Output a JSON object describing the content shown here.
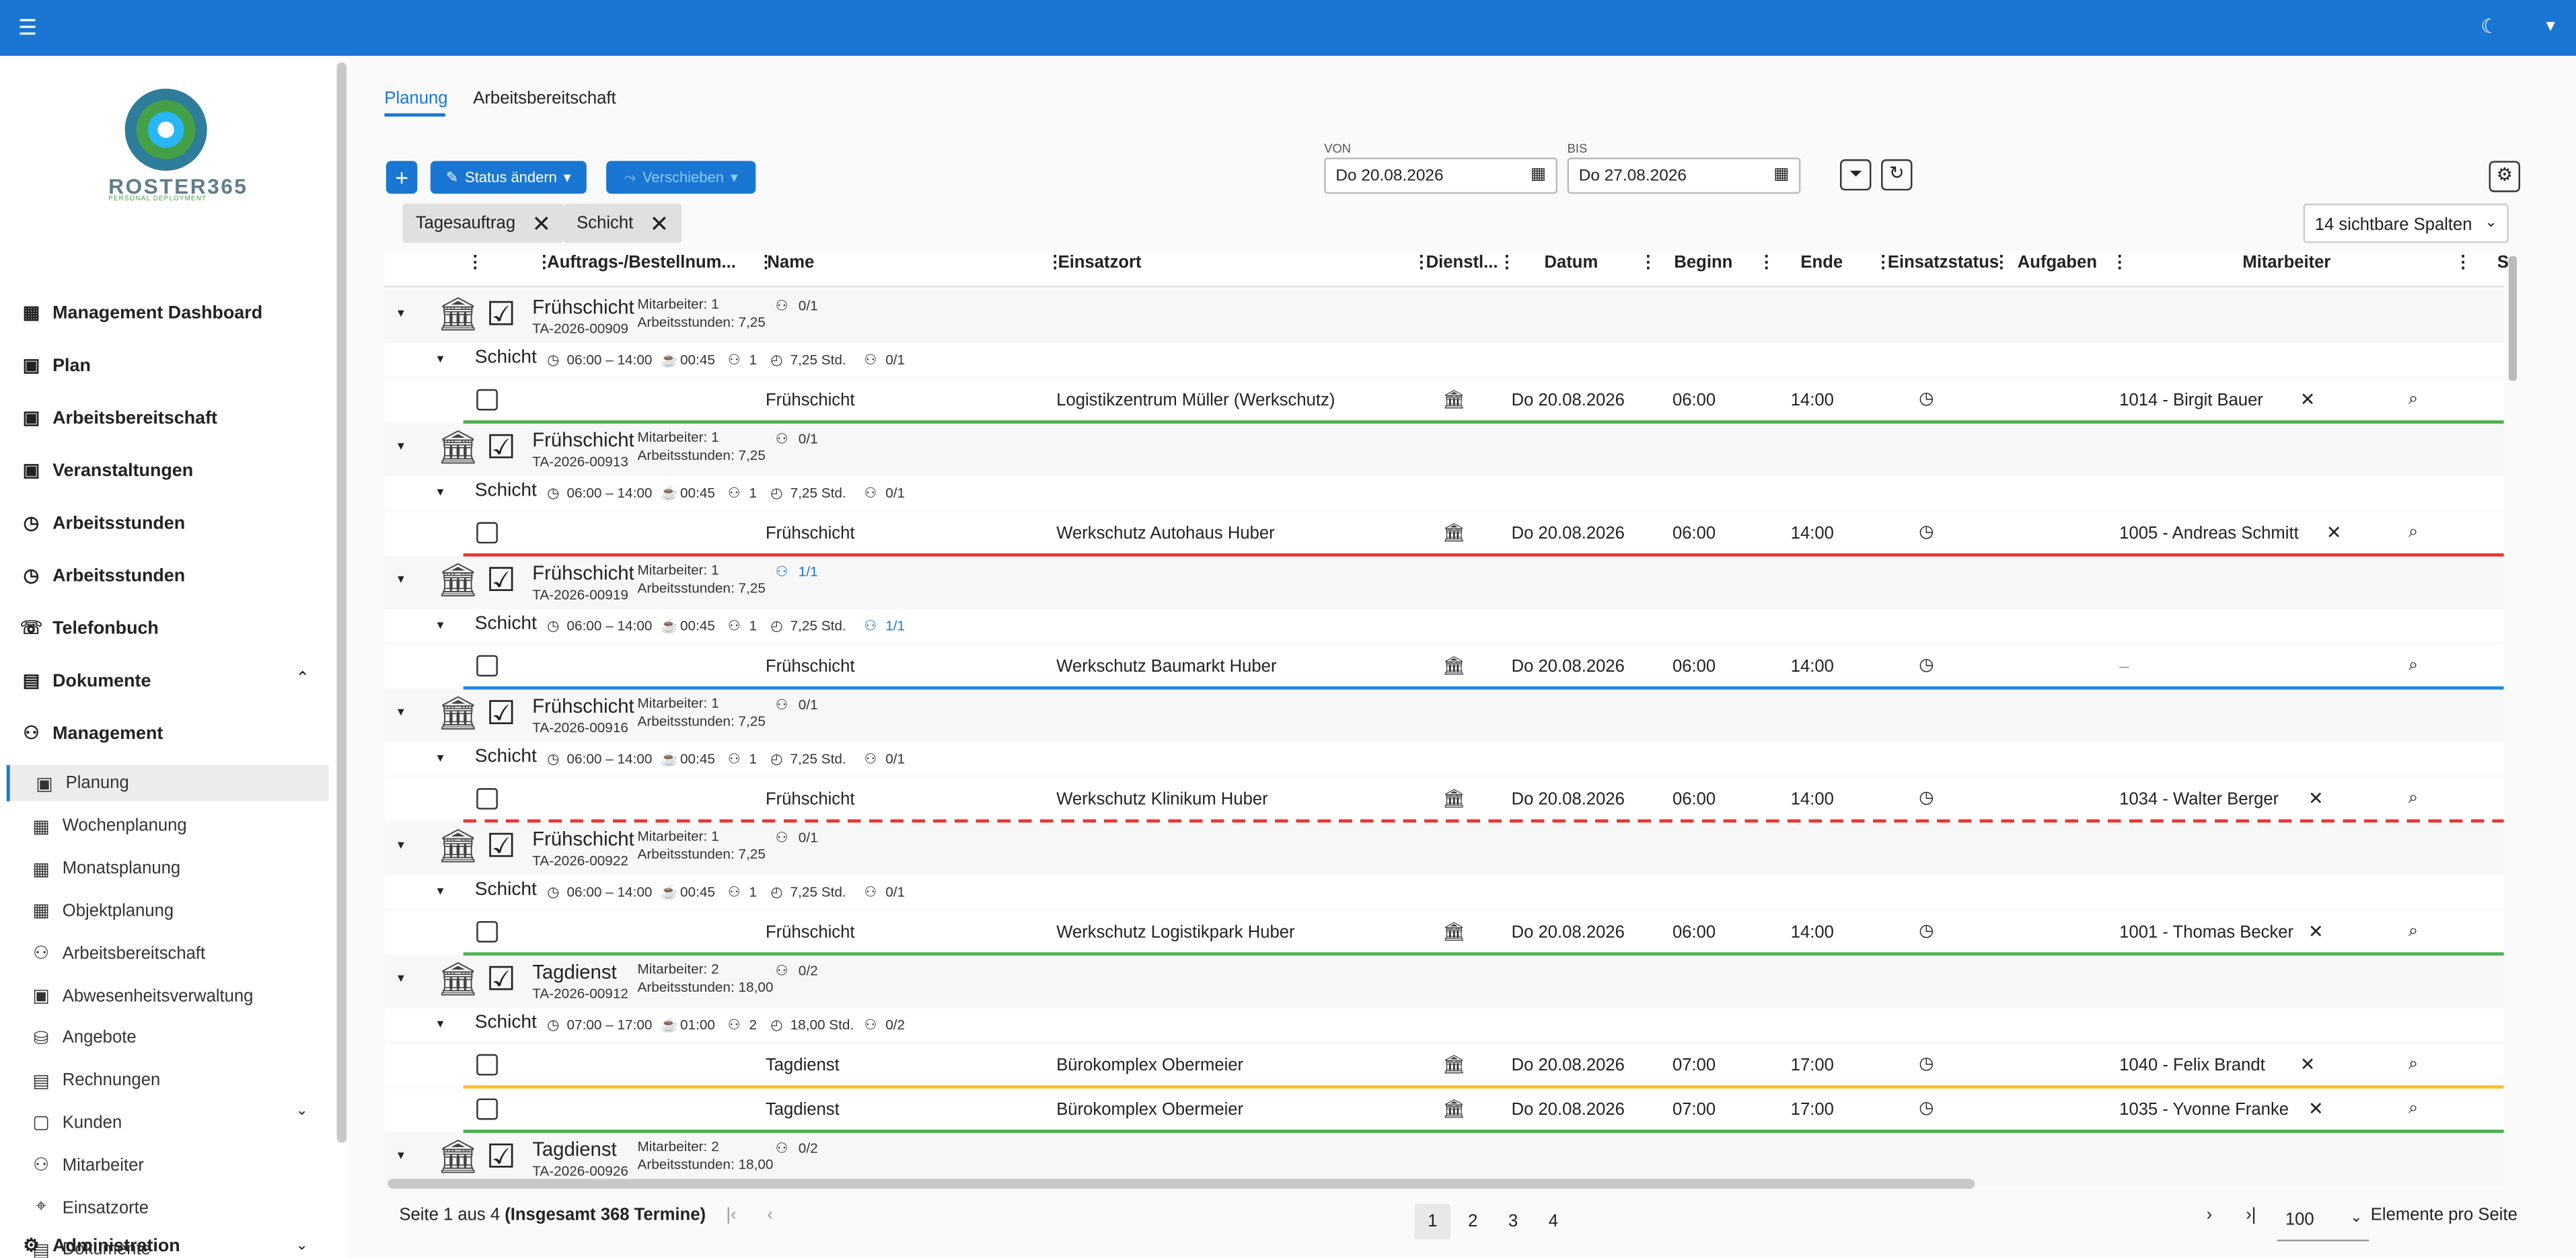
{
  "topbar": {
    "menu_icon": "menu-icon",
    "theme_icon": "moon-icon",
    "user_icon": "user-icon"
  },
  "logo": {
    "text": "ROSTER365",
    "tagline": "PERSONAL DEPLOYMENT"
  },
  "sidebar": {
    "main": [
      {
        "label": "Management Dashboard",
        "icon": "dashboard-icon"
      },
      {
        "label": "Plan",
        "icon": "calendar-icon"
      },
      {
        "label": "Arbeitsbereitschaft",
        "icon": "calendar-user-icon"
      },
      {
        "label": "Veranstaltungen",
        "icon": "calendar-icon"
      },
      {
        "label": "Arbeitsstunden",
        "icon": "clock-calendar-icon"
      },
      {
        "label": "Arbeitsstunden",
        "icon": "clock-calendar-icon"
      },
      {
        "label": "Telefonbuch",
        "icon": "phone-icon"
      },
      {
        "label": "Dokumente",
        "icon": "document-icon"
      },
      {
        "label": "Management",
        "icon": "people-icon"
      }
    ],
    "management_items": [
      "Planung",
      "Wochenplanung",
      "Monatsplanung",
      "Objektplanung",
      "Arbeitsbereitschaft",
      "Abwesenheitsverwaltung",
      "Angebote",
      "Rechnungen",
      "Kunden",
      "Mitarbeiter",
      "Einsatzorte",
      "Dokumente"
    ],
    "administration": "Administration"
  },
  "tabs": [
    "Planung",
    "Arbeitsbereitschaft"
  ],
  "toolbar": {
    "add": "+",
    "status": "Status ändern",
    "move": "Verschieben",
    "von_label": "VON",
    "von": "Do 20.08.2026",
    "bis_label": "BIS",
    "bis": "Do 27.08.2026",
    "columns": "14 sichtbare Spalten"
  },
  "chips": [
    "Tagesauftrag",
    "Schicht"
  ],
  "columns": [
    "Auftrags-/Bestellnum...",
    "Name",
    "Einsatzort",
    "Dienstl...",
    "Datum",
    "Beginn",
    "Ende",
    "Einsatzstatus",
    "Aufgaben",
    "Mitarbeiter",
    "S"
  ],
  "groups": [
    {
      "name": "Frühschicht",
      "number": "TA-2026-00909",
      "mitarbeiter": "Mitarbeiter: 1",
      "stunden": "Arbeitsstunden: 7,25",
      "staff": "0/1",
      "shift": {
        "label": "Schicht",
        "time": "06:00 – 14:00",
        "pause": "00:45",
        "count": "1",
        "hours": "7,25 Std.",
        "staff": "0/1"
      },
      "rows": [
        {
          "name": "Frühschicht",
          "ort": "Logistikzentrum Müller (Werkschutz)",
          "datum": "Do 20.08.2026",
          "beginn": "06:00",
          "ende": "14:00",
          "mitarbeiter": "1014 - Birgit Bauer"
        }
      ]
    },
    {
      "name": "Frühschicht",
      "number": "TA-2026-00913",
      "mitarbeiter": "Mitarbeiter: 1",
      "stunden": "Arbeitsstunden: 7,25",
      "staff": "0/1",
      "shift": {
        "label": "Schicht",
        "time": "06:00 – 14:00",
        "pause": "00:45",
        "count": "1",
        "hours": "7,25 Std.",
        "staff": "0/1"
      },
      "rows": [
        {
          "name": "Frühschicht",
          "ort": "Werkschutz Autohaus Huber",
          "datum": "Do 20.08.2026",
          "beginn": "06:00",
          "ende": "14:00",
          "mitarbeiter": "1005 - Andreas Schmitt"
        }
      ]
    },
    {
      "name": "Frühschicht",
      "number": "TA-2026-00919",
      "mitarbeiter": "Mitarbeiter: 1",
      "stunden": "Arbeitsstunden: 7,25",
      "staff": "1/1",
      "shift": {
        "label": "Schicht",
        "time": "06:00 – 14:00",
        "pause": "00:45",
        "count": "1",
        "hours": "7,25 Std.",
        "staff": "1/1"
      },
      "rows": [
        {
          "name": "Frühschicht",
          "ort": "Werkschutz Baumarkt Huber",
          "datum": "Do 20.08.2026",
          "beginn": "06:00",
          "ende": "14:00",
          "mitarbeiter": "–"
        }
      ]
    },
    {
      "name": "Frühschicht",
      "number": "TA-2026-00916",
      "mitarbeiter": "Mitarbeiter: 1",
      "stunden": "Arbeitsstunden: 7,25",
      "staff": "0/1",
      "shift": {
        "label": "Schicht",
        "time": "06:00 – 14:00",
        "pause": "00:45",
        "count": "1",
        "hours": "7,25 Std.",
        "staff": "0/1"
      },
      "rows": [
        {
          "name": "Frühschicht",
          "ort": "Werkschutz Klinikum Huber",
          "datum": "Do 20.08.2026",
          "beginn": "06:00",
          "ende": "14:00",
          "mitarbeiter": "1034 - Walter Berger"
        }
      ]
    },
    {
      "name": "Frühschicht",
      "number": "TA-2026-00922",
      "mitarbeiter": "Mitarbeiter: 1",
      "stunden": "Arbeitsstunden: 7,25",
      "staff": "0/1",
      "shift": {
        "label": "Schicht",
        "time": "06:00 – 14:00",
        "pause": "00:45",
        "count": "1",
        "hours": "7,25 Std.",
        "staff": "0/1"
      },
      "rows": [
        {
          "name": "Frühschicht",
          "ort": "Werkschutz Logistikpark Huber",
          "datum": "Do 20.08.2026",
          "beginn": "06:00",
          "ende": "14:00",
          "mitarbeiter": "1001 - Thomas Becker"
        }
      ]
    },
    {
      "name": "Tagdienst",
      "number": "TA-2026-00912",
      "mitarbeiter": "Mitarbeiter: 2",
      "stunden": "Arbeitsstunden: 18,00",
      "staff": "0/2",
      "shift": {
        "label": "Schicht",
        "time": "07:00 – 17:00",
        "pause": "01:00",
        "count": "2",
        "hours": "18,00 Std.",
        "staff": "0/2"
      },
      "rows": [
        {
          "name": "Tagdienst",
          "ort": "Bürokomplex Obermeier",
          "datum": "Do 20.08.2026",
          "beginn": "07:00",
          "ende": "17:00",
          "mitarbeiter": "1040 - Felix Brandt"
        },
        {
          "name": "Tagdienst",
          "ort": "Bürokomplex Obermeier",
          "datum": "Do 20.08.2026",
          "beginn": "07:00",
          "ende": "17:00",
          "mitarbeiter": "1035 - Yvonne Franke"
        }
      ]
    },
    {
      "name": "Tagdienst",
      "number": "TA-2026-00926",
      "mitarbeiter": "Mitarbeiter: 2",
      "stunden": "Arbeitsstunden: 18,00",
      "staff": "0/2"
    }
  ],
  "pagination": {
    "info_prefix": "Seite 1 aus 4 ",
    "info_bold": "(Insgesamt 368 Termine)",
    "pages": [
      "1",
      "2",
      "3",
      "4"
    ],
    "per_page": "100",
    "per_page_label": "Elemente pro Seite"
  },
  "colors": {
    "primary": "#1976d2",
    "green": "#4caf50",
    "red": "#e53935",
    "blue": "#1e88e5",
    "yellow": "#fbc02d"
  }
}
